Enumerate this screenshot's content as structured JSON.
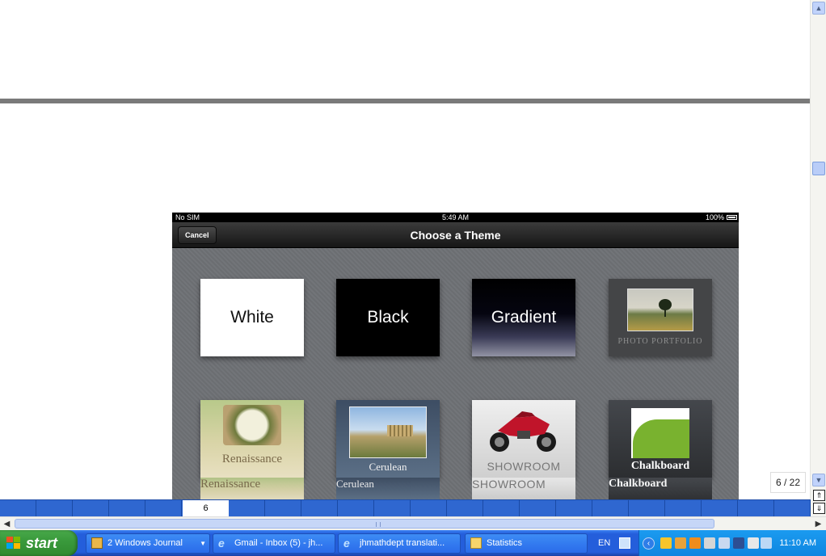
{
  "ipad": {
    "carrier": "No SIM",
    "time": "5:49 AM",
    "battery": "100%",
    "nav_title": "Choose a Theme",
    "cancel_label": "Cancel",
    "themes": [
      {
        "name": "White"
      },
      {
        "name": "Black"
      },
      {
        "name": "Gradient"
      },
      {
        "name": "PHOTO PORTFOLIO"
      },
      {
        "name": "Renaissance"
      },
      {
        "name": "Cerulean"
      },
      {
        "name": "SHOWROOM"
      },
      {
        "name": "Chalkboard"
      }
    ]
  },
  "viewer": {
    "page_counter": "6 / 22",
    "active_page": "6"
  },
  "taskbar": {
    "start_label": "start",
    "tasks": [
      {
        "label": "2 Windows Journal"
      },
      {
        "label": "Gmail - Inbox (5) - jh..."
      },
      {
        "label": "jhmathdept translati..."
      },
      {
        "label": "Statistics"
      }
    ],
    "language": "EN",
    "clock": "11:10 AM"
  },
  "colors": {
    "taskbar_blue": "#245edb",
    "start_green": "#3a9a3c",
    "page_strip_blue": "#2f67d0",
    "nav_bar": "#1e1e1e"
  }
}
